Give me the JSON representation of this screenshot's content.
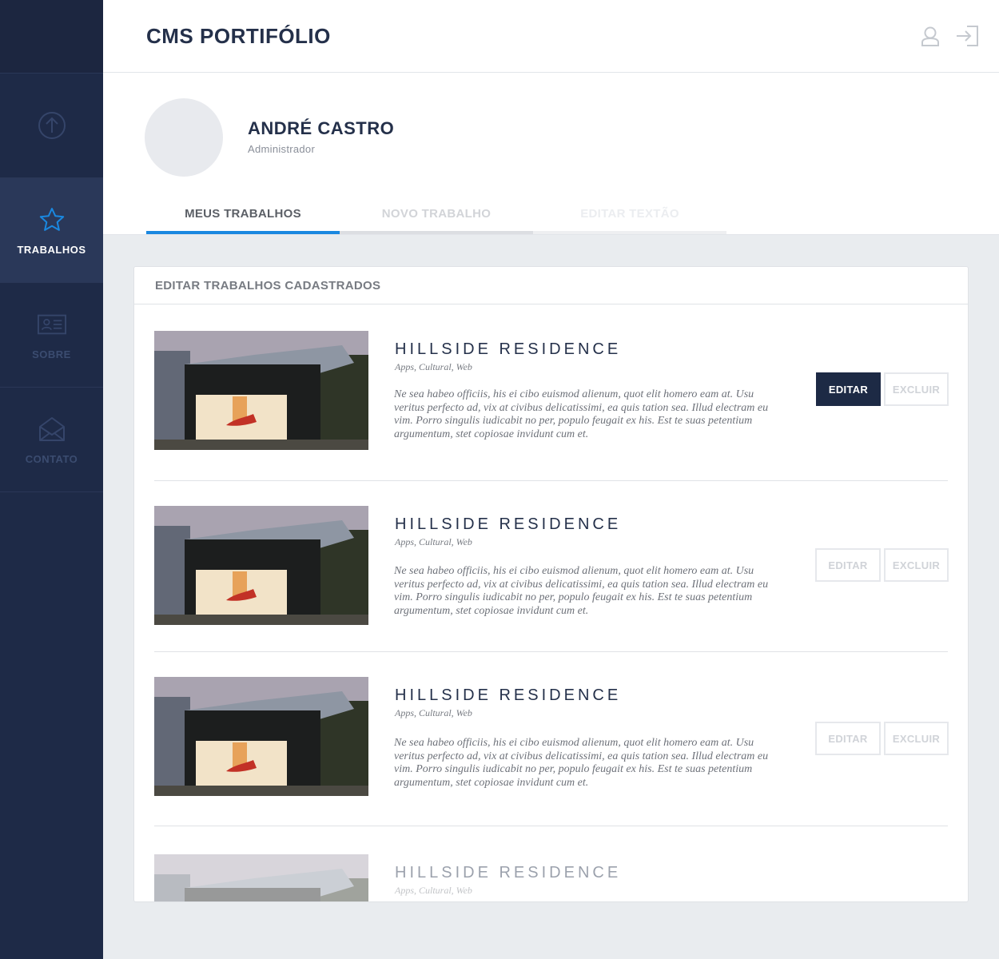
{
  "app": {
    "title": "CMS PORTIFÓLIO"
  },
  "sidebar": {
    "items": [
      {
        "label": "",
        "icon": "upload-icon"
      },
      {
        "label": "TRABALHOS",
        "icon": "star-icon"
      },
      {
        "label": "SOBRE",
        "icon": "id-card-icon"
      },
      {
        "label": "CONTATO",
        "icon": "envelope-icon"
      }
    ]
  },
  "header": {
    "user_icon": "user-icon",
    "logout_icon": "logout-icon"
  },
  "profile": {
    "name": "ANDRÉ CASTRO",
    "role": "Administrador"
  },
  "tabs": [
    {
      "label": "MEUS TRABALHOS"
    },
    {
      "label": "NOVO TRABALHO"
    },
    {
      "label": "EDITAR TEXTÃO"
    }
  ],
  "panel": {
    "title": "EDITAR TRABALHOS CADASTRADOS"
  },
  "works": [
    {
      "title": "HILLSIDE RESIDENCE",
      "tags": "Apps, Cultural, Web",
      "desc": "Ne sea habeo officiis, his ei cibo euismod alienum, quot elit homero eam at. Usu veritus perfecto ad, vix at civibus delicatissimi, ea quis tation sea. Illud electram eu vim. Porro singulis iudicabit no per, populo feugait ex his. Est te suas petentium argumentum, stet copiosae invidunt cum et.",
      "edit": "EDITAR",
      "delete": "EXCLUIR"
    },
    {
      "title": "HILLSIDE RESIDENCE",
      "tags": "Apps, Cultural, Web",
      "desc": "Ne sea habeo officiis, his ei cibo euismod alienum, quot elit homero eam at. Usu veritus perfecto ad, vix at civibus delicatissimi, ea quis tation sea. Illud electram eu vim. Porro singulis iudicabit no per, populo feugait ex his. Est te suas petentium argumentum, stet copiosae invidunt cum et.",
      "edit": "EDITAR",
      "delete": "EXCLUIR"
    },
    {
      "title": "HILLSIDE RESIDENCE",
      "tags": "Apps, Cultural, Web",
      "desc": "Ne sea habeo officiis, his ei cibo euismod alienum, quot elit homero eam at. Usu veritus perfecto ad, vix at civibus delicatissimi, ea quis tation sea. Illud electram eu vim. Porro singulis iudicabit no per, populo feugait ex his. Est te suas petentium argumentum, stet copiosae invidunt cum et.",
      "edit": "EDITAR",
      "delete": "EXCLUIR"
    },
    {
      "title": "HILLSIDE RESIDENCE",
      "tags": "Apps, Cultural, Web"
    }
  ],
  "colors": {
    "sidebar": "#1e2a47",
    "accent": "#1a88e0",
    "primary_button": "#1d2a45"
  }
}
